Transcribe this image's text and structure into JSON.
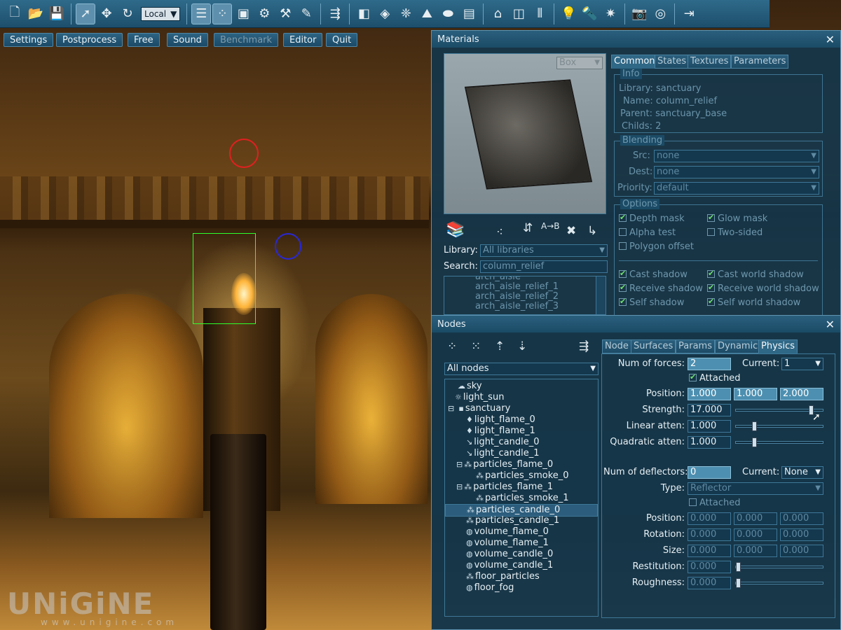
{
  "toolbar": {
    "mode_select": "Local",
    "icons": [
      "new-icon",
      "open-icon",
      "save-icon",
      "select-icon",
      "move-icon",
      "rotate-icon",
      "list-icon",
      "nodes-icon",
      "image-icon",
      "gear-icon",
      "tools-icon",
      "edit-icon",
      "import-icon",
      "box-icon",
      "mesh-icon",
      "particles-icon",
      "terrain-icon",
      "object-icon",
      "layers-icon",
      "building-icon",
      "portal-icon",
      "bars-icon",
      "light-icon",
      "spot-icon",
      "star-icon",
      "camera-icon",
      "screen-icon",
      "exit-icon"
    ]
  },
  "menu": {
    "settings": "Settings",
    "postprocess": "Postprocess",
    "free": "Free",
    "sound": "Sound",
    "benchmark": "Benchmark",
    "editor": "Editor",
    "quit": "Quit"
  },
  "materials": {
    "title": "Materials",
    "preview_select": "Box",
    "tabs": {
      "common": "Common",
      "states": "States",
      "textures": "Textures",
      "parameters": "Parameters"
    },
    "info": {
      "title": "Info",
      "library": "Library: sanctuary",
      "name": "Name: column_relief",
      "parent": "Parent: sanctuary_base",
      "childs": "Childs: 2"
    },
    "blending": {
      "title": "Blending",
      "src_label": "Src:",
      "src_value": "none",
      "dest_label": "Dest:",
      "dest_value": "none",
      "priority_label": "Priority:",
      "priority_value": "default"
    },
    "options": {
      "title": "Options",
      "depth_mask": "Depth mask",
      "glow_mask": "Glow mask",
      "alpha_test": "Alpha test",
      "two_sided": "Two-sided",
      "polygon_offset": "Polygon offset",
      "cast_shadow": "Cast shadow",
      "cast_world_shadow": "Cast world shadow",
      "receive_shadow": "Receive shadow",
      "receive_world_shadow": "Receive world shadow",
      "self_shadow": "Self shadow",
      "self_world_shadow": "Self world shadow"
    },
    "library_label": "Library:",
    "library_value": "All libraries",
    "search_label": "Search:",
    "search_value": "column_relief",
    "list": [
      "arch_aisle",
      "arch_aisle_relief_1",
      "arch_aisle_relief_2",
      "arch_aisle_relief_3"
    ]
  },
  "nodes": {
    "title": "Nodes",
    "filter": "All nodes",
    "tabs": {
      "node": "Node",
      "surfaces": "Surfaces",
      "params": "Params",
      "dynamic": "Dynamic",
      "physics": "Physics"
    },
    "tree": [
      {
        "label": "sky",
        "icon": "sky-icon"
      },
      {
        "label": "light_sun",
        "icon": "sun-icon"
      },
      {
        "label": "sanctuary",
        "icon": "object-icon"
      },
      {
        "label": "light_flame_0",
        "icon": "bulb-icon"
      },
      {
        "label": "light_flame_1",
        "icon": "bulb-icon"
      },
      {
        "label": "light_candle_0",
        "icon": "spot-icon"
      },
      {
        "label": "light_candle_1",
        "icon": "spot-icon"
      },
      {
        "label": "particles_flame_0",
        "icon": "particles-icon"
      },
      {
        "label": "particles_smoke_0",
        "icon": "particles-icon"
      },
      {
        "label": "particles_flame_1",
        "icon": "particles-icon"
      },
      {
        "label": "particles_smoke_1",
        "icon": "particles-icon"
      },
      {
        "label": "particles_candle_0",
        "icon": "particles-icon"
      },
      {
        "label": "particles_candle_1",
        "icon": "particles-icon"
      },
      {
        "label": "volume_flame_0",
        "icon": "volume-icon"
      },
      {
        "label": "volume_flame_1",
        "icon": "volume-icon"
      },
      {
        "label": "volume_candle_0",
        "icon": "volume-icon"
      },
      {
        "label": "volume_candle_1",
        "icon": "volume-icon"
      },
      {
        "label": "floor_particles",
        "icon": "particles-icon"
      },
      {
        "label": "floor_fog",
        "icon": "volume-icon"
      }
    ],
    "physics": {
      "num_forces_label": "Num of forces:",
      "num_forces": "2",
      "current_label": "Current:",
      "current_force": "1",
      "attached": "Attached",
      "position_label": "Position:",
      "position": [
        "1.000",
        "1.000",
        "2.000"
      ],
      "strength_label": "Strength:",
      "strength": "17.000",
      "strength_level": 0.9,
      "linear_label": "Linear atten:",
      "linear": "1.000",
      "linear_level": 0.2,
      "quadratic_label": "Quadratic atten:",
      "quadratic": "1.000",
      "quadratic_level": 0.2,
      "num_deflectors_label": "Num of deflectors:",
      "num_deflectors": "0",
      "current_deflector": "None",
      "type_label": "Type:",
      "type": "Reflector",
      "def_attached": "Attached",
      "def_position_label": "Position:",
      "def_position": [
        "0.000",
        "0.000",
        "0.000"
      ],
      "rotation_label": "Rotation:",
      "rotation": [
        "0.000",
        "0.000",
        "0.000"
      ],
      "size_label": "Size:",
      "size": [
        "0.000",
        "0.000",
        "0.000"
      ],
      "restitution_label": "Restitution:",
      "restitution": "0.000",
      "roughness_label": "Roughness:",
      "roughness": "0.000"
    }
  },
  "watermark": {
    "logo": "UNiGiNE",
    "url": "www.unigine.com"
  }
}
